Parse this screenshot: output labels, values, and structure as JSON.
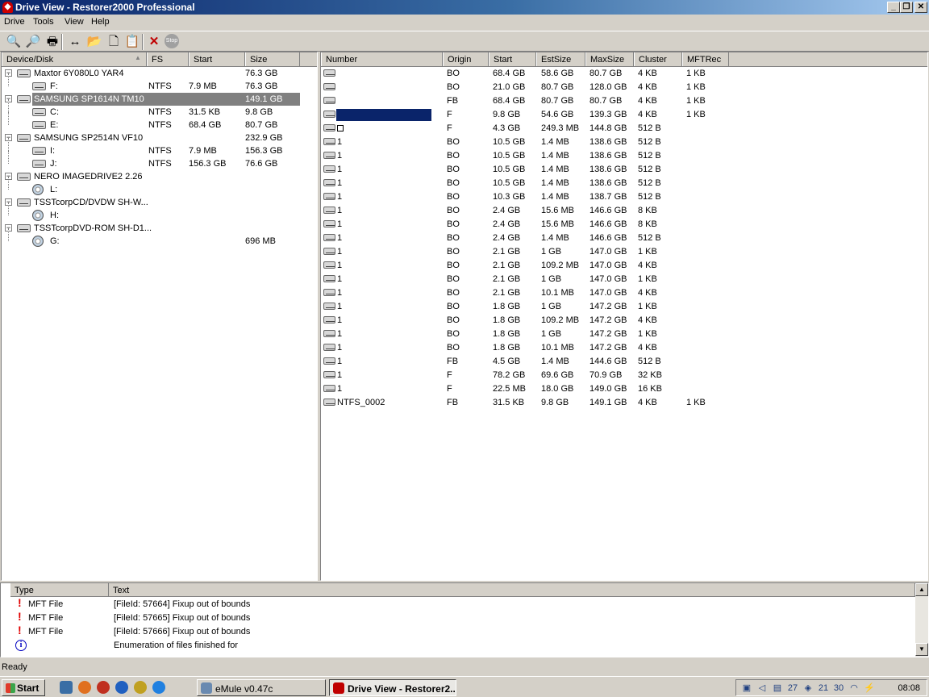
{
  "window": {
    "title": "Drive View - Restorer2000 Professional",
    "app_icon": "restorer-icon",
    "min": "_",
    "max": "❐",
    "close": "✕"
  },
  "menu": [
    "Drive",
    "Tools",
    "View",
    "Help"
  ],
  "toolbar": {
    "items": [
      {
        "name": "scan-icon",
        "glyph": "🔍"
      },
      {
        "name": "search-icon",
        "glyph": "🔎"
      },
      {
        "name": "print-icon",
        "glyph": "🖶"
      },
      {
        "name": "resize-icon",
        "glyph": "↔"
      },
      {
        "name": "open-icon",
        "glyph": "📂"
      },
      {
        "name": "copy-icon",
        "glyph": "🗋"
      },
      {
        "name": "paste-icon",
        "glyph": "📋"
      },
      {
        "name": "delete-icon",
        "glyph": "✕"
      },
      {
        "name": "stop-icon",
        "glyph": "Stop"
      }
    ]
  },
  "device_tree": {
    "columns": [
      "Device/Disk",
      "FS",
      "Start",
      "Size"
    ],
    "sort_indicator": "▲",
    "rows": [
      {
        "level": 0,
        "label": "Maxtor 6Y080L0 YAR4",
        "fs": "",
        "start": "",
        "size": "76.3 GB",
        "icon": "hdd"
      },
      {
        "level": 1,
        "label": "F:",
        "fs": "NTFS",
        "start": "7.9 MB",
        "size": "76.3 GB",
        "icon": "hdd"
      },
      {
        "level": 0,
        "label": "SAMSUNG SP1614N TM10",
        "fs": "",
        "start": "",
        "size": "149.1 GB",
        "icon": "hdd",
        "selected": true
      },
      {
        "level": 1,
        "label": "C:",
        "fs": "NTFS",
        "start": "31.5 KB",
        "size": "9.8 GB",
        "icon": "hdd"
      },
      {
        "level": 1,
        "label": "E:",
        "fs": "NTFS",
        "start": "68.4 GB",
        "size": "80.7 GB",
        "icon": "hdd"
      },
      {
        "level": 0,
        "label": "SAMSUNG SP2514N VF10",
        "fs": "",
        "start": "",
        "size": "232.9 GB",
        "icon": "hdd"
      },
      {
        "level": 1,
        "label": "I:",
        "fs": "NTFS",
        "start": "7.9 MB",
        "size": "156.3 GB",
        "icon": "hdd"
      },
      {
        "level": 1,
        "label": "J:",
        "fs": "NTFS",
        "start": "156.3 GB",
        "size": "76.6 GB",
        "icon": "hdd"
      },
      {
        "level": 0,
        "label": "NERO IMAGEDRIVE2 2.26",
        "fs": "",
        "start": "",
        "size": "",
        "icon": "hdd"
      },
      {
        "level": 1,
        "label": "L:",
        "fs": "",
        "start": "",
        "size": "",
        "icon": "cd"
      },
      {
        "level": 0,
        "label": "TSSTcorpCD/DVDW SH-W...",
        "fs": "",
        "start": "",
        "size": "",
        "icon": "hdd"
      },
      {
        "level": 1,
        "label": "H:",
        "fs": "",
        "start": "",
        "size": "",
        "icon": "cd"
      },
      {
        "level": 0,
        "label": "TSSTcorpDVD-ROM SH-D1...",
        "fs": "",
        "start": "",
        "size": "",
        "icon": "hdd"
      },
      {
        "level": 1,
        "label": "G:",
        "fs": "",
        "start": "",
        "size": "696 MB",
        "icon": "cd"
      }
    ]
  },
  "partitions": {
    "columns": [
      "Number",
      "Origin",
      "Start",
      "EstSize",
      "MaxSize",
      "Cluster",
      "MFTRec"
    ],
    "rows": [
      {
        "number": "",
        "origin": "BO",
        "start": "68.4 GB",
        "est": "58.6 GB",
        "max": "80.7 GB",
        "cluster": "4 KB",
        "mft": "1 KB"
      },
      {
        "number": "",
        "origin": "BO",
        "start": "21.0 GB",
        "est": "80.7 GB",
        "max": "128.0 GB",
        "cluster": "4 KB",
        "mft": "1 KB"
      },
      {
        "number": "",
        "origin": "FB",
        "start": "68.4 GB",
        "est": "80.7 GB",
        "max": "80.7 GB",
        "cluster": "4 KB",
        "mft": "1 KB"
      },
      {
        "number": "",
        "origin": "F",
        "start": "9.8 GB",
        "est": "54.6 GB",
        "max": "139.3 GB",
        "cluster": "4 KB",
        "mft": "1 KB",
        "selected": true
      },
      {
        "number": "",
        "origin": "F",
        "start": "4.3 GB",
        "est": "249.3 MB",
        "max": "144.8 GB",
        "cluster": "512 B",
        "mft": "",
        "box": true
      },
      {
        "number": "1",
        "origin": "BO",
        "start": "10.5 GB",
        "est": "1.4 MB",
        "max": "138.6 GB",
        "cluster": "512 B",
        "mft": ""
      },
      {
        "number": "1",
        "origin": "BO",
        "start": "10.5 GB",
        "est": "1.4 MB",
        "max": "138.6 GB",
        "cluster": "512 B",
        "mft": ""
      },
      {
        "number": "1",
        "origin": "BO",
        "start": "10.5 GB",
        "est": "1.4 MB",
        "max": "138.6 GB",
        "cluster": "512 B",
        "mft": ""
      },
      {
        "number": "1",
        "origin": "BO",
        "start": "10.5 GB",
        "est": "1.4 MB",
        "max": "138.6 GB",
        "cluster": "512 B",
        "mft": ""
      },
      {
        "number": "1",
        "origin": "BO",
        "start": "10.3 GB",
        "est": "1.4 MB",
        "max": "138.7 GB",
        "cluster": "512 B",
        "mft": ""
      },
      {
        "number": "1",
        "origin": "BO",
        "start": "2.4 GB",
        "est": "15.6 MB",
        "max": "146.6 GB",
        "cluster": "8 KB",
        "mft": ""
      },
      {
        "number": "1",
        "origin": "BO",
        "start": "2.4 GB",
        "est": "15.6 MB",
        "max": "146.6 GB",
        "cluster": "8 KB",
        "mft": ""
      },
      {
        "number": "1",
        "origin": "BO",
        "start": "2.4 GB",
        "est": "1.4 MB",
        "max": "146.6 GB",
        "cluster": "512 B",
        "mft": ""
      },
      {
        "number": "1",
        "origin": "BO",
        "start": "2.1 GB",
        "est": "1 GB",
        "max": "147.0 GB",
        "cluster": "1 KB",
        "mft": ""
      },
      {
        "number": "1",
        "origin": "BO",
        "start": "2.1 GB",
        "est": "109.2 MB",
        "max": "147.0 GB",
        "cluster": "4 KB",
        "mft": ""
      },
      {
        "number": "1",
        "origin": "BO",
        "start": "2.1 GB",
        "est": "1 GB",
        "max": "147.0 GB",
        "cluster": "1 KB",
        "mft": ""
      },
      {
        "number": "1",
        "origin": "BO",
        "start": "2.1 GB",
        "est": "10.1 MB",
        "max": "147.0 GB",
        "cluster": "4 KB",
        "mft": ""
      },
      {
        "number": "1",
        "origin": "BO",
        "start": "1.8 GB",
        "est": "1 GB",
        "max": "147.2 GB",
        "cluster": "1 KB",
        "mft": ""
      },
      {
        "number": "1",
        "origin": "BO",
        "start": "1.8 GB",
        "est": "109.2 MB",
        "max": "147.2 GB",
        "cluster": "4 KB",
        "mft": ""
      },
      {
        "number": "1",
        "origin": "BO",
        "start": "1.8 GB",
        "est": "1 GB",
        "max": "147.2 GB",
        "cluster": "1 KB",
        "mft": ""
      },
      {
        "number": "1",
        "origin": "BO",
        "start": "1.8 GB",
        "est": "10.1 MB",
        "max": "147.2 GB",
        "cluster": "4 KB",
        "mft": ""
      },
      {
        "number": "1",
        "origin": "FB",
        "start": "4.5 GB",
        "est": "1.4 MB",
        "max": "144.6 GB",
        "cluster": "512 B",
        "mft": ""
      },
      {
        "number": "1",
        "origin": "F",
        "start": "78.2 GB",
        "est": "69.6 GB",
        "max": "70.9 GB",
        "cluster": "32 KB",
        "mft": ""
      },
      {
        "number": "1",
        "origin": "F",
        "start": "22.5 MB",
        "est": "18.0 GB",
        "max": "149.0 GB",
        "cluster": "16 KB",
        "mft": ""
      },
      {
        "number": "NTFS_0002",
        "origin": "FB",
        "start": "31.5 KB",
        "est": "9.8 GB",
        "max": "149.1 GB",
        "cluster": "4 KB",
        "mft": "1 KB"
      }
    ]
  },
  "log": {
    "close": "×",
    "columns": [
      "Type",
      "Text"
    ],
    "rows": [
      {
        "icon": "error",
        "type": "MFT File",
        "text": "[FileId: 57664] Fixup out of bounds"
      },
      {
        "icon": "error",
        "type": "MFT File",
        "text": "[FileId: 57665] Fixup out of bounds"
      },
      {
        "icon": "error",
        "type": "MFT File",
        "text": "[FileId: 57666] Fixup out of bounds"
      },
      {
        "icon": "info",
        "type": "",
        "text": "Enumeration of files finished for"
      }
    ]
  },
  "status": "Ready",
  "taskbar": {
    "start": "Start",
    "quicklaunch": [
      {
        "name": "show-desktop-icon",
        "color": "#3a6ea5"
      },
      {
        "name": "firefox-icon",
        "color": "#e07020"
      },
      {
        "name": "browser-icon",
        "color": "#c03020"
      },
      {
        "name": "share-icon",
        "color": "#2060c0"
      },
      {
        "name": "tool-icon",
        "color": "#c0a020"
      },
      {
        "name": "globe-icon",
        "color": "#2080e0"
      }
    ],
    "tasks": [
      {
        "label": "eMule v0.47c",
        "active": false,
        "color": "#6a8ab0"
      },
      {
        "label": "Drive View - Restorer2...",
        "active": true,
        "color": "#c00000"
      }
    ],
    "tray": [
      "network-icon",
      "volume-icon",
      "monitor-icon",
      "info-icon",
      "tray-app-icon",
      "calendar-icon",
      "mouse-icon",
      "usb-icon",
      "antivirus-icon"
    ],
    "tray_glyphs": [
      "▣",
      "◁",
      "▤",
      "27",
      "◈",
      "21",
      "30",
      "◠",
      "⚡"
    ],
    "clock": "08:08"
  }
}
